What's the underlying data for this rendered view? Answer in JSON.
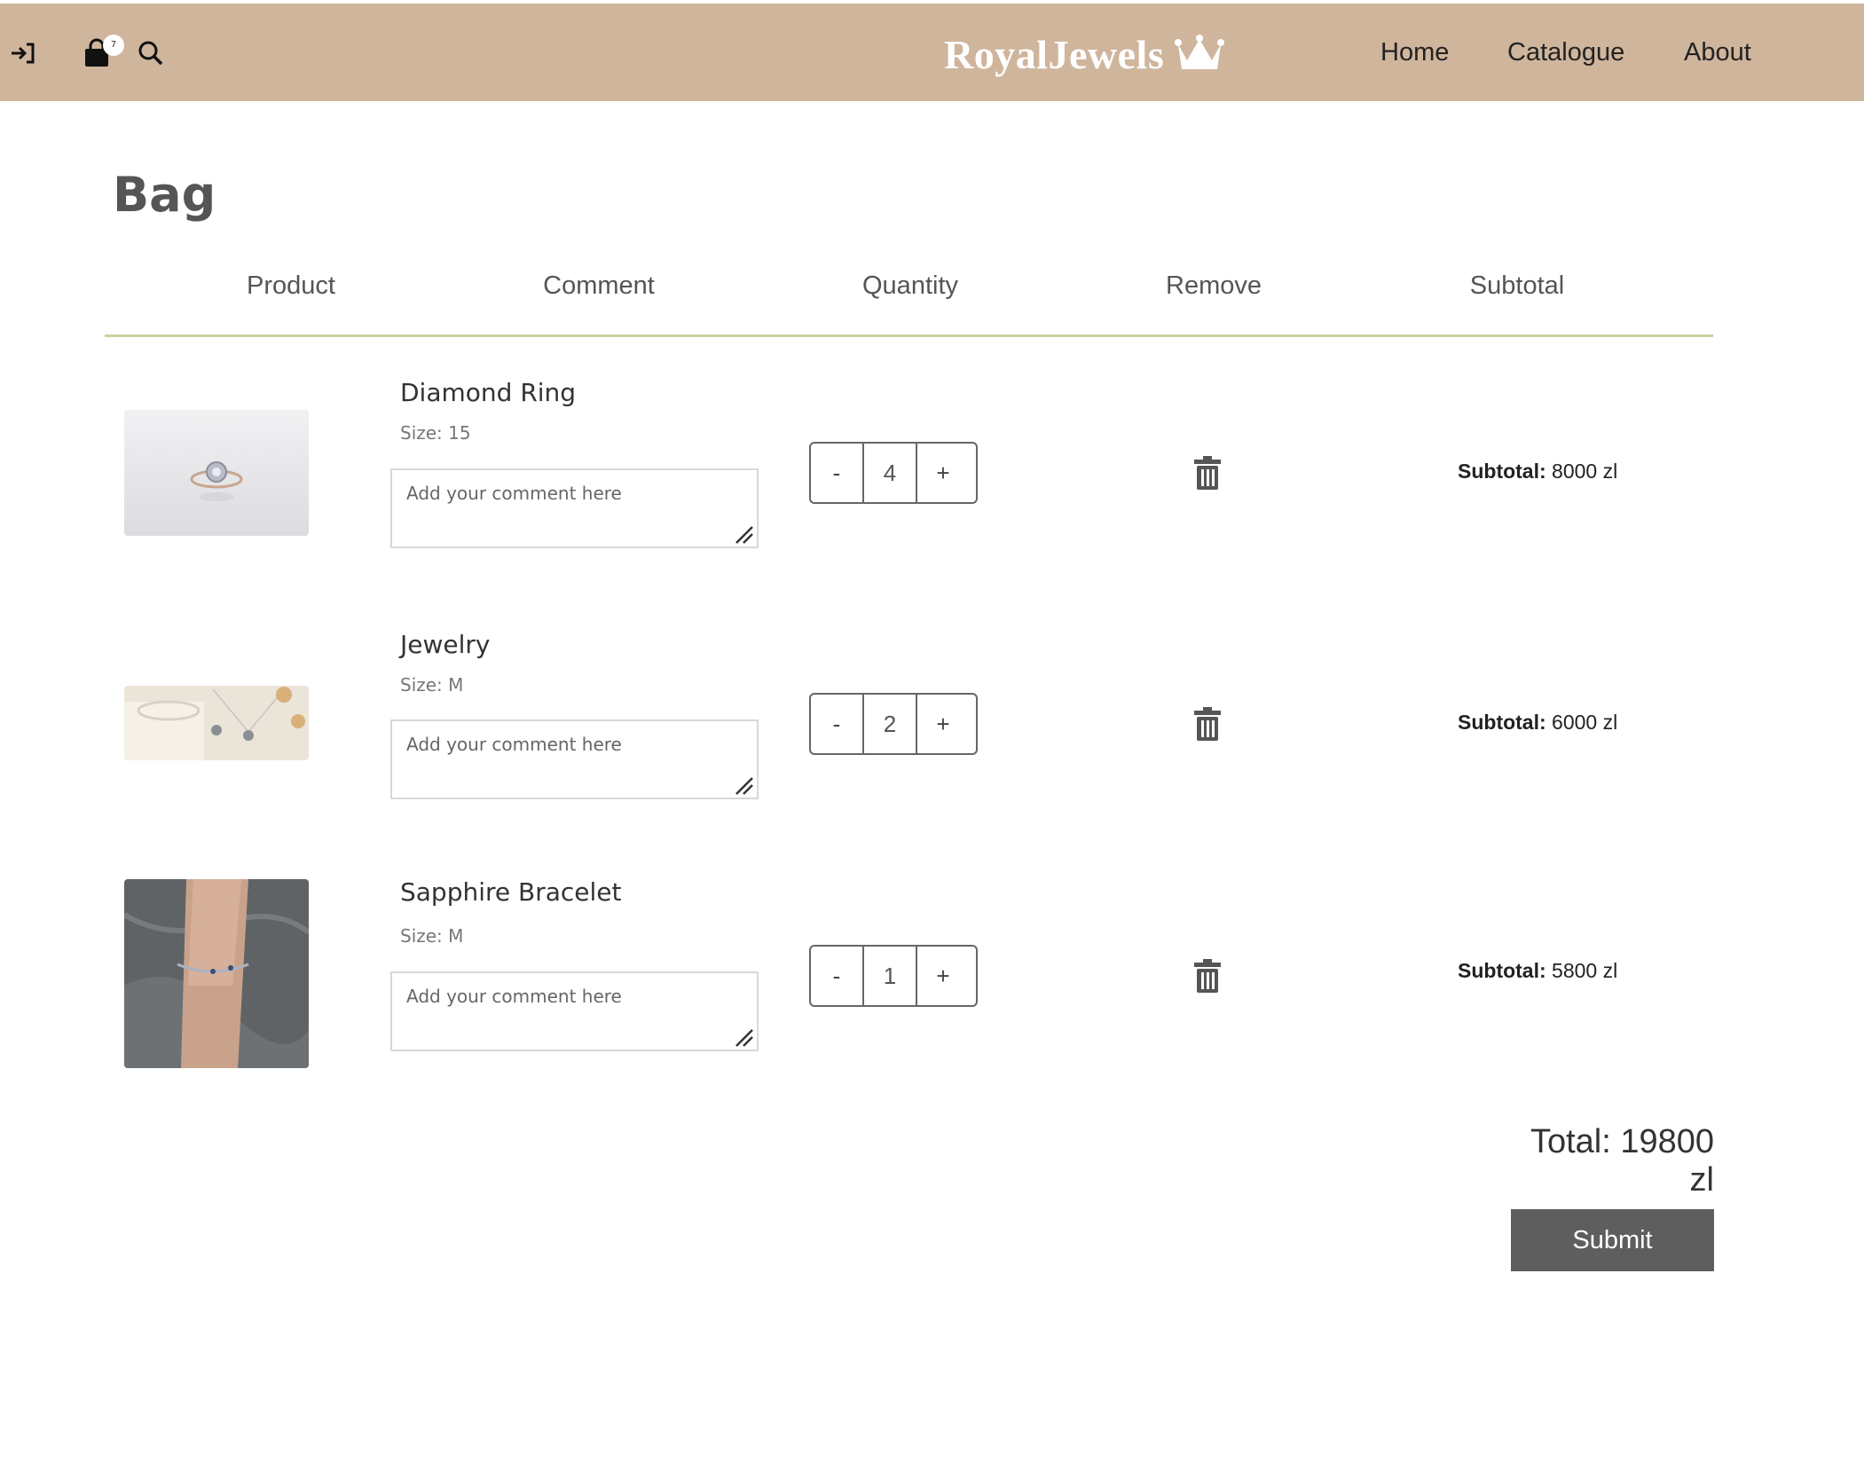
{
  "header": {
    "brand": "RoyalJewels",
    "bag_count": "7",
    "nav": {
      "home": "Home",
      "catalogue": "Catalogue",
      "about": "About"
    }
  },
  "page": {
    "title": "Bag"
  },
  "columns": {
    "product": "Product",
    "comment": "Comment",
    "quantity": "Quantity",
    "remove": "Remove",
    "subtotal": "Subtotal"
  },
  "items": [
    {
      "name": "Diamond Ring",
      "size": "Size: 15",
      "comment_placeholder": "Add your comment here",
      "qty": "4",
      "minus": "-",
      "plus": "+",
      "subtotal_label": "Subtotal:",
      "subtotal_value": "8000 zl"
    },
    {
      "name": "Jewelry",
      "size": "Size: M",
      "comment_placeholder": "Add your comment here",
      "qty": "2",
      "minus": "-",
      "plus": "+",
      "subtotal_label": "Subtotal:",
      "subtotal_value": "6000 zl"
    },
    {
      "name": "Sapphire Bracelet",
      "size": "Size: M",
      "comment_placeholder": "Add your comment here",
      "qty": "1",
      "minus": "-",
      "plus": "+",
      "subtotal_label": "Subtotal:",
      "subtotal_value": "5800 zl"
    }
  ],
  "summary": {
    "total": "Total: 19800 zl",
    "submit": "Submit"
  },
  "colors": {
    "header_bg": "#cfb59c",
    "divider": "#c8d2a3",
    "submit_bg": "#5e5e5e"
  },
  "icons": [
    "login-icon",
    "bag-icon",
    "search-icon",
    "crown-icon",
    "trash-icon"
  ]
}
